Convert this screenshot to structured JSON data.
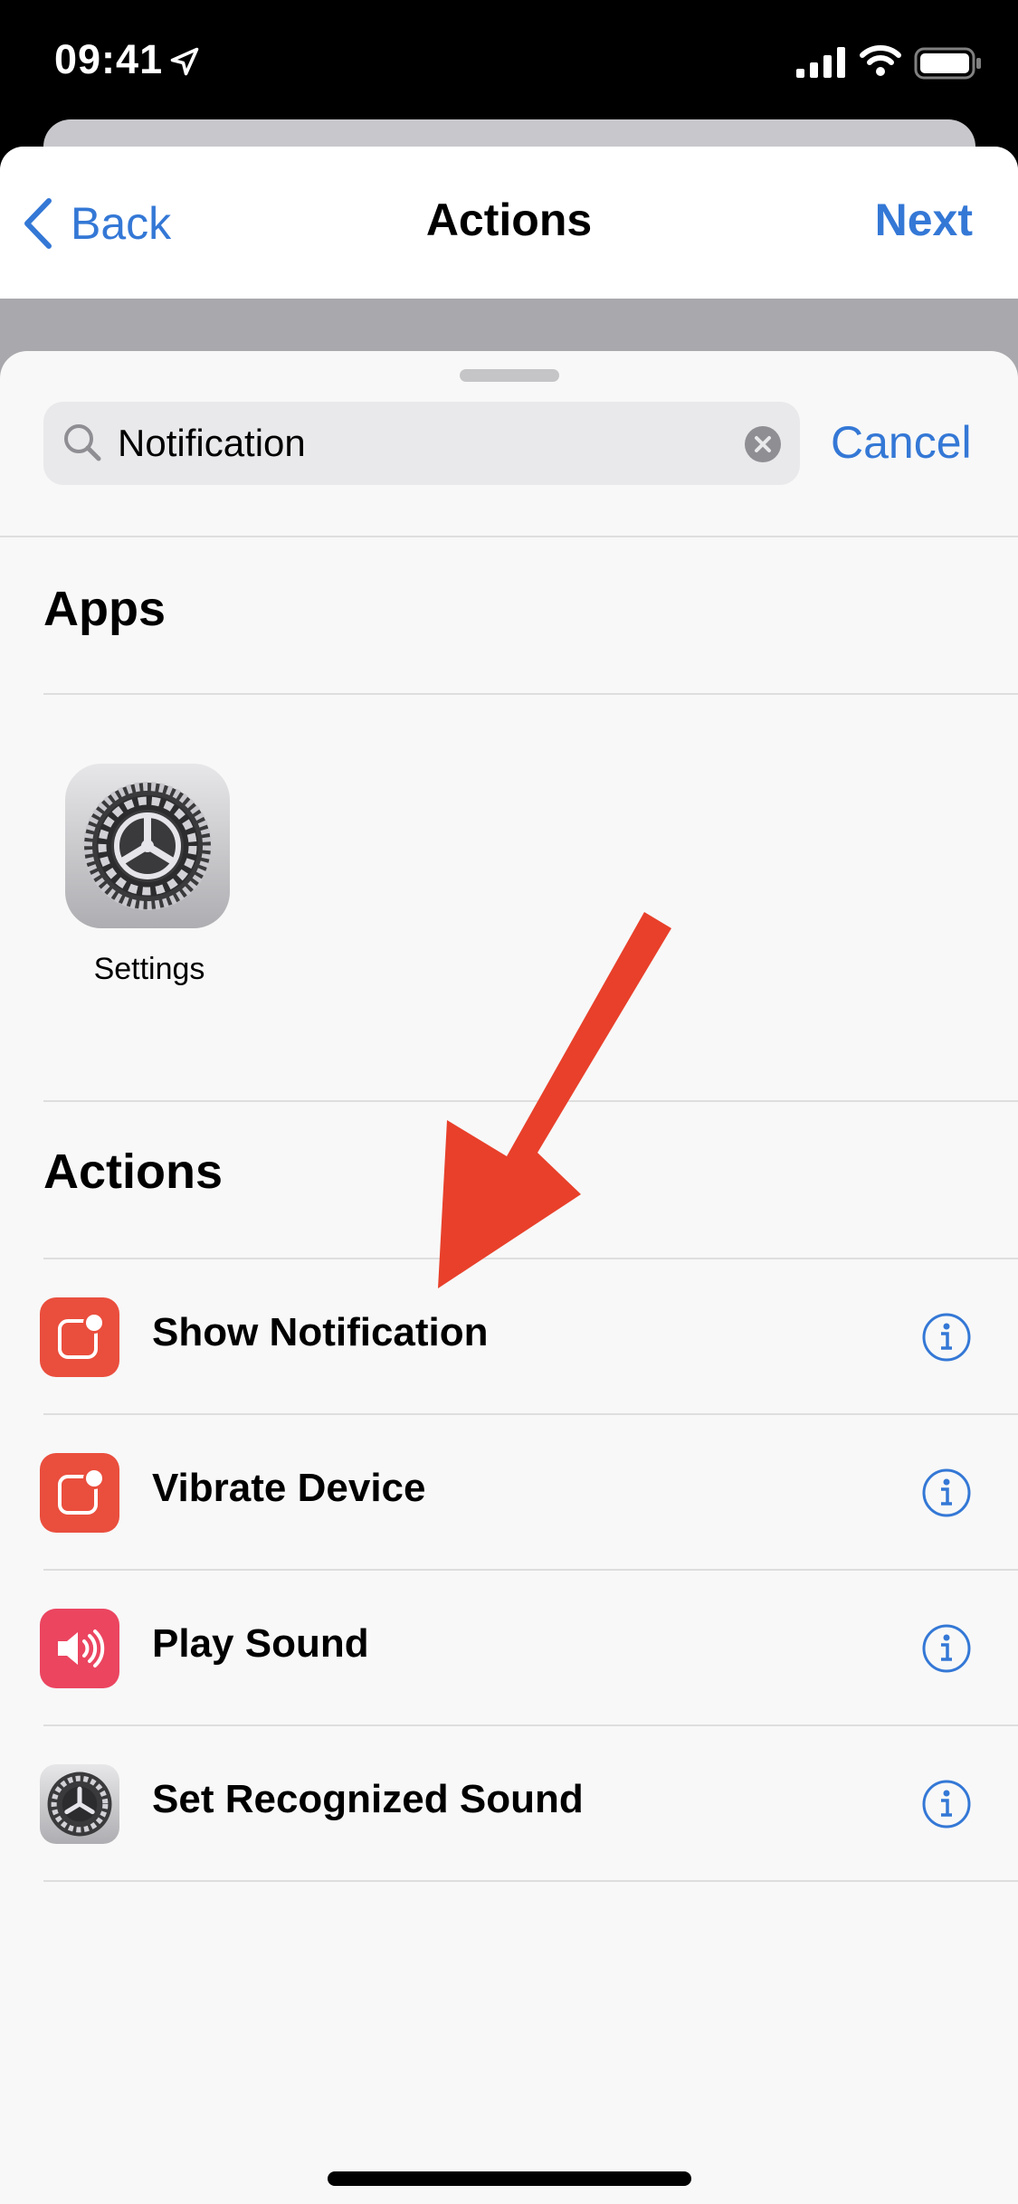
{
  "status_bar": {
    "time": "09:41",
    "icons": [
      "location-arrow-icon",
      "cellular-signal-icon",
      "wifi-icon",
      "battery-icon"
    ]
  },
  "nav": {
    "back_label": "Back",
    "title": "Actions",
    "next_label": "Next"
  },
  "search": {
    "value": "Notification",
    "placeholder": "Search",
    "cancel_label": "Cancel"
  },
  "apps_section": {
    "title": "Apps",
    "apps": [
      {
        "label": "Settings",
        "icon": "settings-gear-icon"
      }
    ]
  },
  "actions_section": {
    "title": "Actions",
    "items": [
      {
        "label": "Show Notification",
        "icon": "notification-badge-icon",
        "color": "#ea4e3d"
      },
      {
        "label": "Vibrate Device",
        "icon": "notification-badge-icon",
        "color": "#ea4e3d"
      },
      {
        "label": "Play Sound",
        "icon": "speaker-icon",
        "color": "#eb4560"
      },
      {
        "label": "Set Recognized Sound",
        "icon": "settings-gear-icon",
        "color": "#8e8e93"
      }
    ]
  },
  "colors": {
    "tint": "#3478d6",
    "annotation_arrow": "#e8402b"
  }
}
